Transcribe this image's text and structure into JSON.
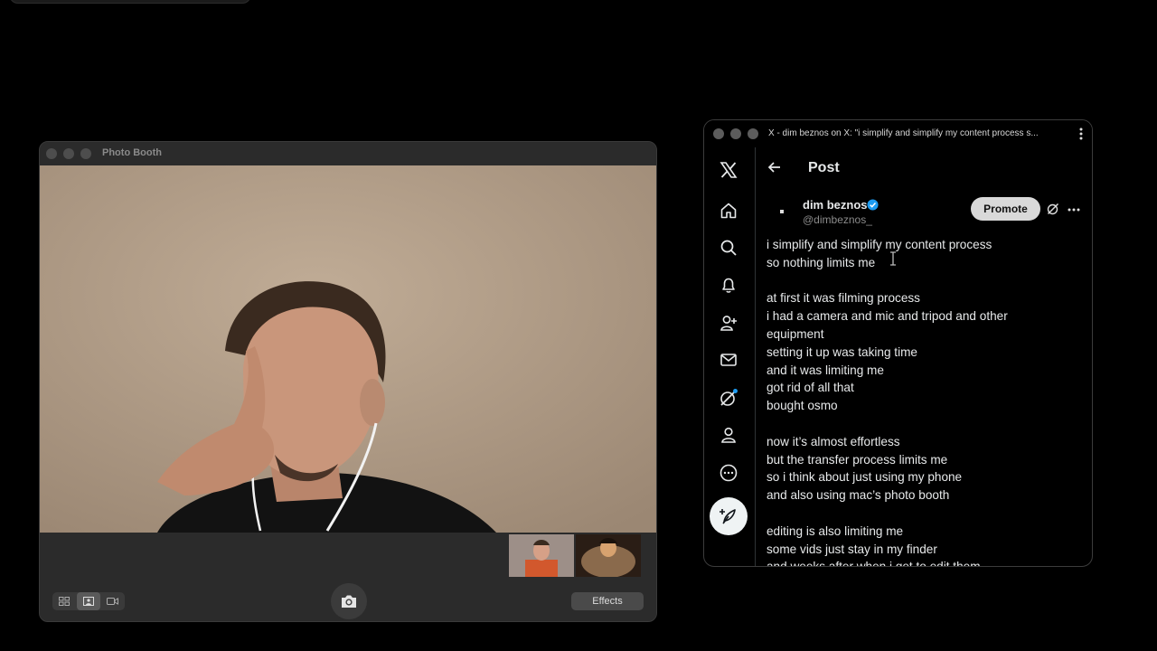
{
  "photo_booth": {
    "title": "Photo Booth",
    "effects_label": "Effects",
    "view_modes": [
      "grid-icon",
      "single-photo-icon",
      "video-icon"
    ],
    "active_view_mode": "single-photo-icon"
  },
  "browser": {
    "tab_title": "X - dim beznos on X: \"i simplify and simplify my content process s..."
  },
  "x": {
    "header_title": "Post",
    "nav": [
      "x-logo-icon",
      "home-icon",
      "search-icon",
      "bell-icon",
      "add-user-icon",
      "mail-icon",
      "grok-icon",
      "profile-icon",
      "more-circle-icon",
      "compose-post-icon"
    ],
    "author": {
      "name": "dim beznos",
      "handle": "@dimbeznos_"
    },
    "promote_label": "Promote",
    "post_lines": [
      "i simplify and simplify my content process",
      "so nothing limits me",
      "",
      "at first it was filming process",
      "i had a camera and mic and tripod and other",
      "equipment",
      "setting it up was taking time",
      "and it was limiting me",
      "got rid of all that",
      "bought osmo",
      "",
      "now it’s almost effortless",
      "but the transfer process limits me",
      "so i think about just using my phone",
      "and also using mac’s photo booth",
      "",
      "editing is also limiting me",
      "some vids just stay in my finder",
      "and weeks after when i get to edit them"
    ],
    "accent_color": "#1d9bf0"
  }
}
